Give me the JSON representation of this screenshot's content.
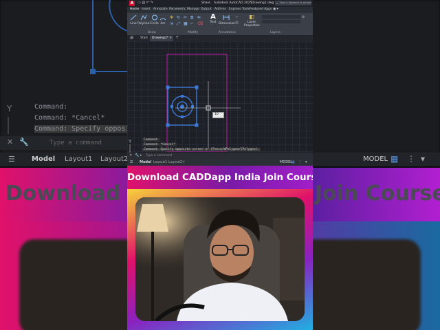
{
  "app": {
    "title": "Autodesk AutoCAD 2025",
    "file": "Drawing1.dwg",
    "share": "Share",
    "search_placeholder": "Type a keyword or phrase",
    "logo": "A"
  },
  "ribbon": {
    "tabs": [
      "Home",
      "Insert",
      "Annotate",
      "Parametric",
      "Manage",
      "Output",
      "Add-ins",
      "Express Tools",
      "Featured Apps"
    ],
    "tools": [
      "Line",
      "Polyline",
      "Circle",
      "Arc",
      "Text",
      "Dimension",
      "Layer Properties"
    ],
    "groups": [
      "Draw",
      "Modify",
      "Annotation",
      "Layers"
    ]
  },
  "file_tabs": {
    "start": "Start",
    "drawing": "Drawing1*"
  },
  "dim_input": "10",
  "command_history": [
    "Command:",
    "Command: *Cancel*",
    "Command: Specify opposite corner or [Fence/WPolygon/CPolygon]:"
  ],
  "command_placeholder": "Type a command",
  "status": {
    "model": "Model",
    "layout1": "Layout1",
    "layout2": "Layout2",
    "model_button": "MODEL"
  },
  "banner": "Download CADDapp India Join Course",
  "background": {
    "cmd_lines": [
      "Command:",
      "Command: *Cancel*",
      "Command: Specify opposit"
    ],
    "command_placeholder": "Type a command",
    "status_model": "Model",
    "status_layout1": "Layout1",
    "status_layout2": "Layout2",
    "status_model_button": "MODEL",
    "banner_left": "Download",
    "banner_right": "Join Course"
  },
  "colors": {
    "banner_pink": "#e0116a",
    "banner_purple": "#7a1aa8",
    "selection_blue": "#3d7ad8",
    "magenta_rect": "#c41aa8",
    "autocad_red": "#c8102e"
  }
}
